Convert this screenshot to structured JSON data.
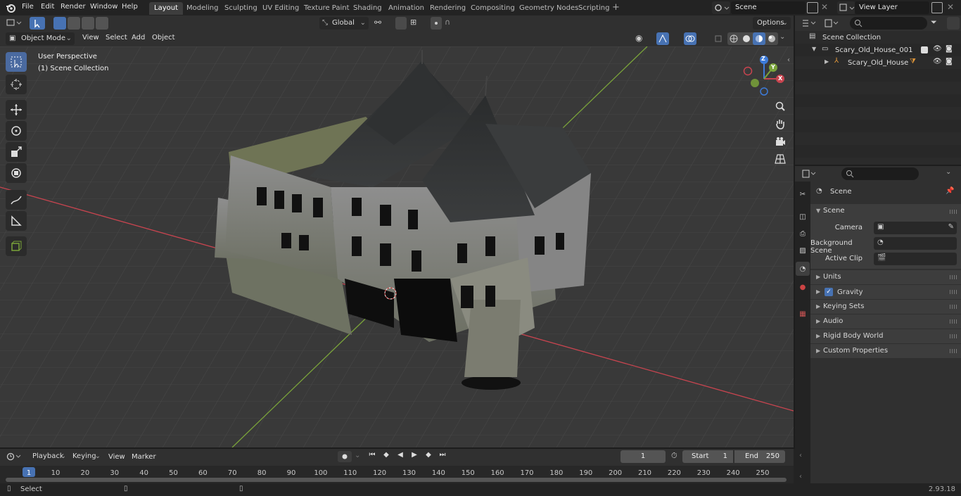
{
  "menus": [
    "File",
    "Edit",
    "Render",
    "Window",
    "Help"
  ],
  "workspaces": [
    {
      "label": "Layout",
      "active": true
    },
    {
      "label": "Modeling",
      "active": false
    },
    {
      "label": "Sculpting",
      "active": false
    },
    {
      "label": "UV Editing",
      "active": false
    },
    {
      "label": "Texture Paint",
      "active": false
    },
    {
      "label": "Shading",
      "active": false
    },
    {
      "label": "Animation",
      "active": false
    },
    {
      "label": "Rendering",
      "active": false
    },
    {
      "label": "Compositing",
      "active": false
    },
    {
      "label": "Geometry Nodes",
      "active": false
    },
    {
      "label": "Scripting",
      "active": false
    }
  ],
  "scene_field": "Scene",
  "view_layer_field": "View Layer",
  "transform_orientation": "Global",
  "options_label": "Options",
  "mode_dropdown": "Object Mode",
  "viewport_menus": [
    "View",
    "Select",
    "Add",
    "Object"
  ],
  "viewport_overlay": {
    "perspective": "User Perspective",
    "collection": "(1) Scene Collection"
  },
  "gizmo_axes": {
    "x": "X",
    "y": "Y",
    "z": "Z"
  },
  "outliner": {
    "root": "Scene Collection",
    "items": [
      {
        "label": "Scary_Old_House_001",
        "depth": 1
      },
      {
        "label": "Scary_Old_House",
        "depth": 2
      }
    ]
  },
  "properties": {
    "context": "Scene",
    "panel": "Scene",
    "fields": [
      {
        "label": "Camera",
        "value": ""
      },
      {
        "label": "Background Scene",
        "value": ""
      },
      {
        "label": "Active Clip",
        "value": ""
      }
    ],
    "sections": [
      {
        "label": "Units",
        "checkbox": false
      },
      {
        "label": "Gravity",
        "checkbox": true,
        "checked": true
      },
      {
        "label": "Keying Sets",
        "checkbox": false
      },
      {
        "label": "Audio",
        "checkbox": false
      },
      {
        "label": "Rigid Body World",
        "checkbox": false
      },
      {
        "label": "Custom Properties",
        "checkbox": false
      }
    ]
  },
  "timeline": {
    "menus": [
      "Playback",
      "Keying",
      "View",
      "Marker"
    ],
    "current_frame": "1",
    "start_label": "Start",
    "start_value": "1",
    "end_label": "End",
    "end_value": "250",
    "ruler": [
      "1",
      "10",
      "20",
      "30",
      "40",
      "50",
      "60",
      "70",
      "80",
      "90",
      "100",
      "110",
      "120",
      "130",
      "140",
      "150",
      "160",
      "170",
      "180",
      "190",
      "200",
      "210",
      "220",
      "230",
      "240",
      "250"
    ]
  },
  "status": {
    "left": "Select",
    "version": "2.93.18"
  },
  "colors": {
    "accent": "#4772b3",
    "x_axis": "#c8444f",
    "y_axis": "#7aa33a",
    "z_axis": "#3d7bd9",
    "playhead": "#4772b3"
  }
}
